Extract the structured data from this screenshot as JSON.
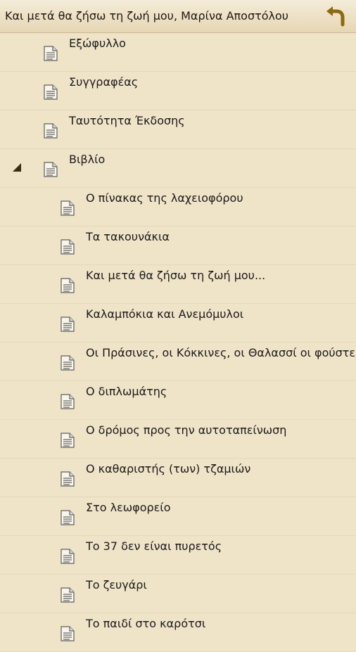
{
  "header": {
    "title": "Και μετά θα ζήσω τη ζωή μου, Μαρίνα Αποστόλου",
    "back_icon": "back-arrow-icon",
    "accent_color": "#8a6a12"
  },
  "toc": {
    "items": [
      {
        "label": "Εξώφυλλο",
        "level": 0,
        "icon": "document-icon"
      },
      {
        "label": "Συγγραφέας",
        "level": 0,
        "icon": "document-icon"
      },
      {
        "label": "Ταυτότητα Έκδοσης",
        "level": 0,
        "icon": "document-icon"
      },
      {
        "label": "Βιβλίο",
        "level": 0,
        "icon": "document-icon",
        "expanded": true
      },
      {
        "label": "Ο πίνακας της λαχειοφόρου",
        "level": 1,
        "icon": "document-icon"
      },
      {
        "label": "Τα τακουνάκια",
        "level": 1,
        "icon": "document-icon"
      },
      {
        "label": "Και μετά θα ζήσω τη ζωή μου...",
        "level": 1,
        "icon": "document-icon"
      },
      {
        "label": "Καλαμπόκια και Ανεμόμυλοι",
        "level": 1,
        "icon": "document-icon"
      },
      {
        "label": "Οι Πράσινες, οι Κόκκινες, οι Θαλασσί οι φούστες",
        "level": 1,
        "icon": "document-icon"
      },
      {
        "label": "Ο διπλωμάτης",
        "level": 1,
        "icon": "document-icon"
      },
      {
        "label": "Ο δρόμος προς την αυτοταπείνωση",
        "level": 1,
        "icon": "document-icon"
      },
      {
        "label": "Ο καθαριστής (των) τζαμιών",
        "level": 1,
        "icon": "document-icon"
      },
      {
        "label": "Στο λεωφορείο",
        "level": 1,
        "icon": "document-icon"
      },
      {
        "label": "Το 37 δεν είναι πυρετός",
        "level": 1,
        "icon": "document-icon"
      },
      {
        "label": "Το ζευγάρι",
        "level": 1,
        "icon": "document-icon"
      },
      {
        "label": "Το παιδί στο καρότσι",
        "level": 1,
        "icon": "document-icon"
      }
    ]
  }
}
